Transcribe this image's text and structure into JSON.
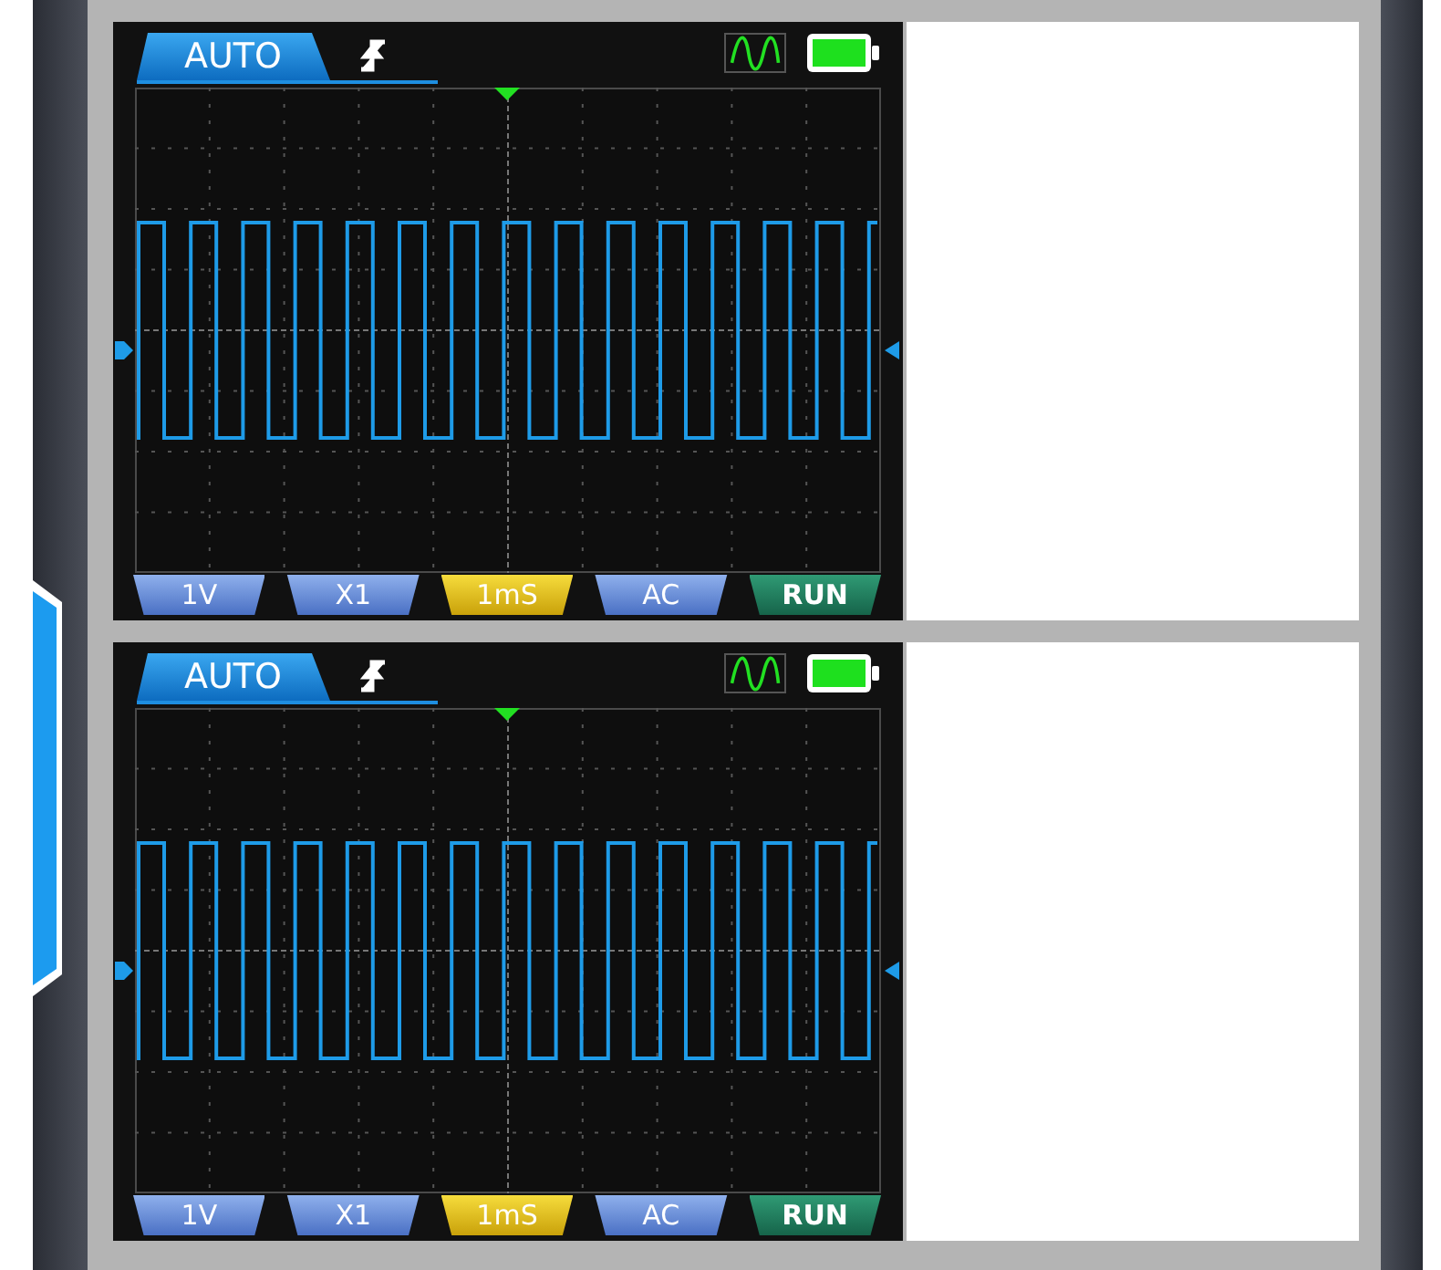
{
  "screens": [
    {
      "mode": "AUTO",
      "buttons": [
        {
          "label": "1V",
          "kind": "setting"
        },
        {
          "label": "X1",
          "kind": "setting"
        },
        {
          "label": "1mS",
          "kind": "highlight"
        },
        {
          "label": "AC",
          "kind": "setting"
        },
        {
          "label": "RUN",
          "kind": "run"
        }
      ]
    },
    {
      "mode": "AUTO",
      "buttons": [
        {
          "label": "1V",
          "kind": "setting"
        },
        {
          "label": "X1",
          "kind": "setting"
        },
        {
          "label": "1mS",
          "kind": "highlight"
        },
        {
          "label": "AC",
          "kind": "setting"
        },
        {
          "label": "RUN",
          "kind": "run"
        }
      ]
    }
  ]
}
